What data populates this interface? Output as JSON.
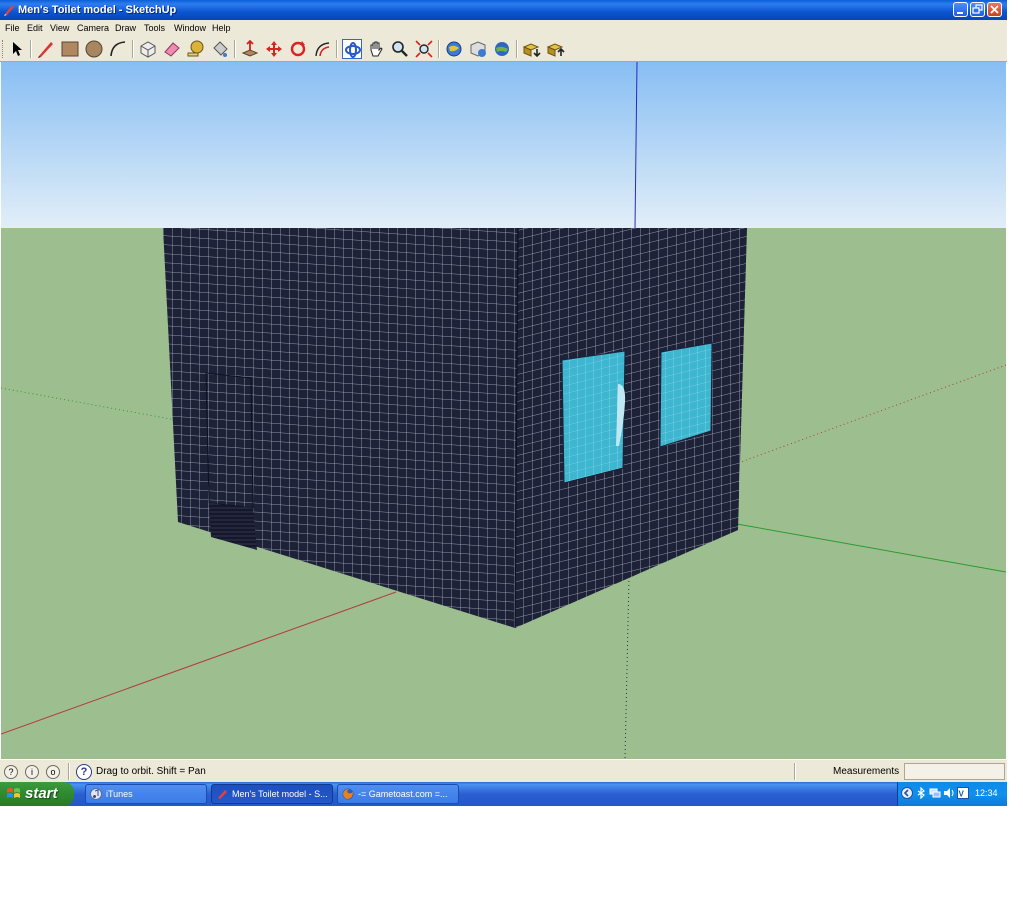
{
  "window": {
    "title": "Men's Toilet model - SketchUp",
    "controls": [
      "minimize",
      "maximize",
      "close"
    ]
  },
  "menu": [
    "File",
    "Edit",
    "View",
    "Camera",
    "Draw",
    "Tools",
    "Window",
    "Help"
  ],
  "toolbar": {
    "tools": [
      {
        "name": "select",
        "icon": "arrow-icon"
      },
      {
        "name": "pencil",
        "icon": "pencil-icon"
      },
      {
        "name": "rectangle",
        "icon": "rectangle-icon"
      },
      {
        "name": "circle",
        "icon": "circle-icon"
      },
      {
        "name": "arc",
        "icon": "arc-icon"
      },
      {
        "name": "make-component",
        "icon": "component-icon"
      },
      {
        "name": "eraser",
        "icon": "eraser-icon"
      },
      {
        "name": "tape-measure",
        "icon": "tape-icon"
      },
      {
        "name": "paint-bucket",
        "icon": "paint-bucket-icon"
      },
      {
        "name": "push-pull",
        "icon": "push-pull-icon"
      },
      {
        "name": "move",
        "icon": "move-icon"
      },
      {
        "name": "rotate",
        "icon": "rotate-icon"
      },
      {
        "name": "offset",
        "icon": "offset-icon"
      },
      {
        "name": "orbit",
        "icon": "orbit-icon",
        "active": true
      },
      {
        "name": "pan",
        "icon": "hand-icon"
      },
      {
        "name": "zoom",
        "icon": "magnifier-icon"
      },
      {
        "name": "zoom-extents",
        "icon": "zoom-extents-icon"
      },
      {
        "name": "get-models",
        "icon": "globe-icon"
      },
      {
        "name": "share-model",
        "icon": "share-icon"
      },
      {
        "name": "google-earth",
        "icon": "earth-icon"
      },
      {
        "name": "get-components",
        "icon": "components-download-icon"
      },
      {
        "name": "share-component",
        "icon": "components-share-icon"
      }
    ]
  },
  "colors": {
    "sky_top": "#87BEF3",
    "sky_bottom": "#E2EEF8",
    "ground": "#9DBF90",
    "wall": "#1D2238",
    "window_glass": "#3EB6D0",
    "axis_red": "#B33A3A",
    "axis_green": "#2D9A2D",
    "axis_blue": "#2B2BB8"
  },
  "statusbar": {
    "hint": "Drag to orbit.  Shift = Pan",
    "measurements_label": "Measurements",
    "measurements_value": ""
  },
  "taskbar": {
    "start_label": "start",
    "tasks": [
      {
        "label": "iTunes",
        "icon": "itunes-icon",
        "active": false
      },
      {
        "label": "Men's Toilet model - S...",
        "icon": "sketchup-icon",
        "active": true
      },
      {
        "label": "-= Gametoast.com =...",
        "icon": "firefox-icon",
        "active": false
      }
    ],
    "clock": "12:34"
  }
}
